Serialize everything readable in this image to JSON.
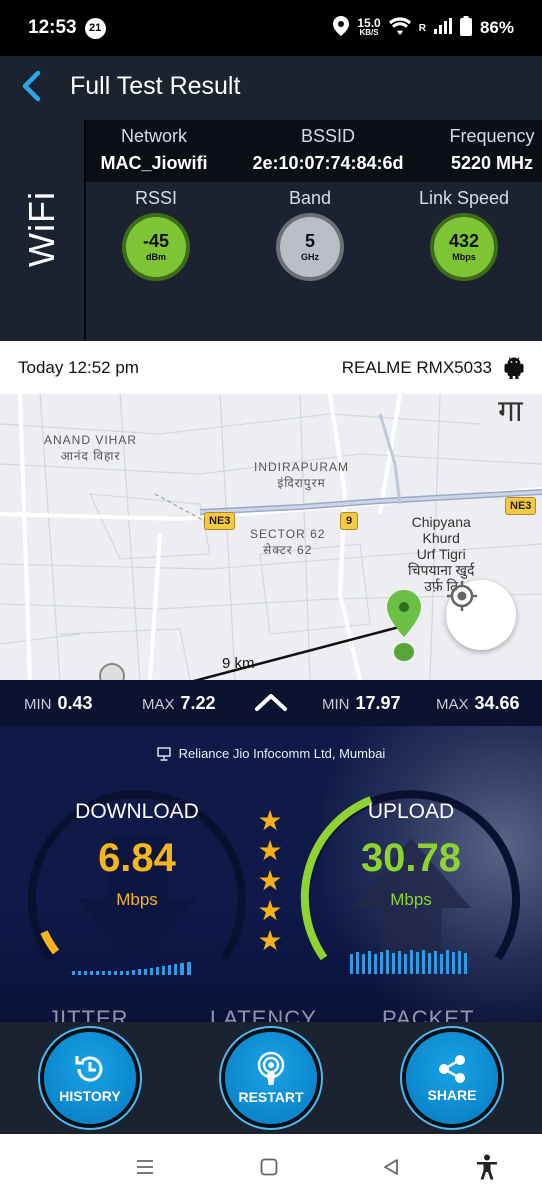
{
  "status_bar": {
    "time": "12:53",
    "notification_count": "21",
    "net_speed": "15.0",
    "net_speed_unit": "KB/S",
    "roaming": "R",
    "battery": "86%"
  },
  "header": {
    "title": "Full Test Result"
  },
  "wifi": {
    "section_label": "WiFi",
    "network_label": "Network",
    "network_value": "MAC_Jiowifi",
    "bssid_label": "BSSID",
    "bssid_value": "2e:10:07:74:84:6d",
    "frequency_label": "Frequency",
    "frequency_value": "5220 MHz",
    "rssi_label": "RSSI",
    "rssi_value": "-45",
    "rssi_unit": "dBm",
    "band_label": "Band",
    "band_value": "5",
    "band_unit": "GHz",
    "link_label": "Link Speed",
    "link_value": "432",
    "link_unit": "Mbps"
  },
  "test_info": {
    "timestamp": "Today 12:52 pm",
    "device": "REALME RMX5033"
  },
  "map": {
    "labels": {
      "anand_vihar": "ANAND VIHAR",
      "anand_vihar_hi": "आनंद विहार",
      "indirapuram": "INDIRAPURAM",
      "indirapuram_hi": "इंदिरापुरम",
      "sector62": "SECTOR 62",
      "sector62_hi": "सेक्टर 62",
      "chipyana_1": "Chipyana",
      "chipyana_2": "Khurd",
      "chipyana_3": "Urf Tigri",
      "chipyana_hi": "चिपयाना खुर्द",
      "chipyana_hi2": "उर्फ़ ति",
      "top_right_hi": "गा"
    },
    "road_tags": {
      "ne3_left": "NE3",
      "route_9": "9",
      "ne3_right": "NE3"
    },
    "distance": "9 km"
  },
  "minmax": {
    "min_label": "MIN",
    "max_label": "MAX",
    "download_min": "0.43",
    "download_max": "7.22",
    "upload_min": "17.97",
    "upload_max": "34.66"
  },
  "speed": {
    "isp": "Reliance Jio Infocomm Ltd, Mumbai",
    "download_title": "DOWNLOAD",
    "download_value": "6.84",
    "download_unit": "Mbps",
    "upload_title": "UPLOAD",
    "upload_value": "30.78",
    "upload_unit": "Mbps",
    "jitter_label": "JITTER",
    "latency_label": "LATENCY",
    "packet_loss_label": "PACKET LOSS",
    "colors": {
      "download": "#f7b51c",
      "upload": "#8fd332",
      "bars": "#2f9be4"
    }
  },
  "actions": {
    "history": "HISTORY",
    "restart": "RESTART",
    "share": "SHARE"
  }
}
